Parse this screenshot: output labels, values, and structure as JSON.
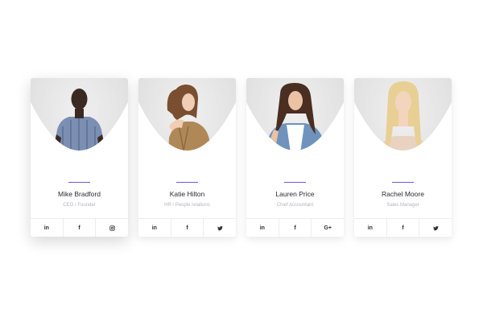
{
  "team": [
    {
      "name": "Mike Bradford",
      "role": "CEO / Founder",
      "social": [
        {
          "icon": "linkedin-icon",
          "glyph": "in"
        },
        {
          "icon": "facebook-icon",
          "glyph": "f"
        },
        {
          "icon": "instagram-icon",
          "glyph": ""
        }
      ]
    },
    {
      "name": "Katie Hilton",
      "role": "HR / People relations",
      "social": [
        {
          "icon": "linkedin-icon",
          "glyph": "in"
        },
        {
          "icon": "facebook-icon",
          "glyph": "f"
        },
        {
          "icon": "twitter-icon",
          "glyph": ""
        }
      ]
    },
    {
      "name": "Lauren Price",
      "role": "Chief Accountant",
      "social": [
        {
          "icon": "linkedin-icon",
          "glyph": "in"
        },
        {
          "icon": "facebook-icon",
          "glyph": "f"
        },
        {
          "icon": "google-plus-icon",
          "glyph": "G+"
        }
      ]
    },
    {
      "name": "Rachel Moore",
      "role": "Sales Manager",
      "social": [
        {
          "icon": "linkedin-icon",
          "glyph": "in"
        },
        {
          "icon": "facebook-icon",
          "glyph": "f"
        },
        {
          "icon": "twitter-icon",
          "glyph": ""
        }
      ]
    }
  ],
  "colors": {
    "accent": "#6a5be0",
    "name": "#2b2b33",
    "role": "#b4b4bf"
  }
}
